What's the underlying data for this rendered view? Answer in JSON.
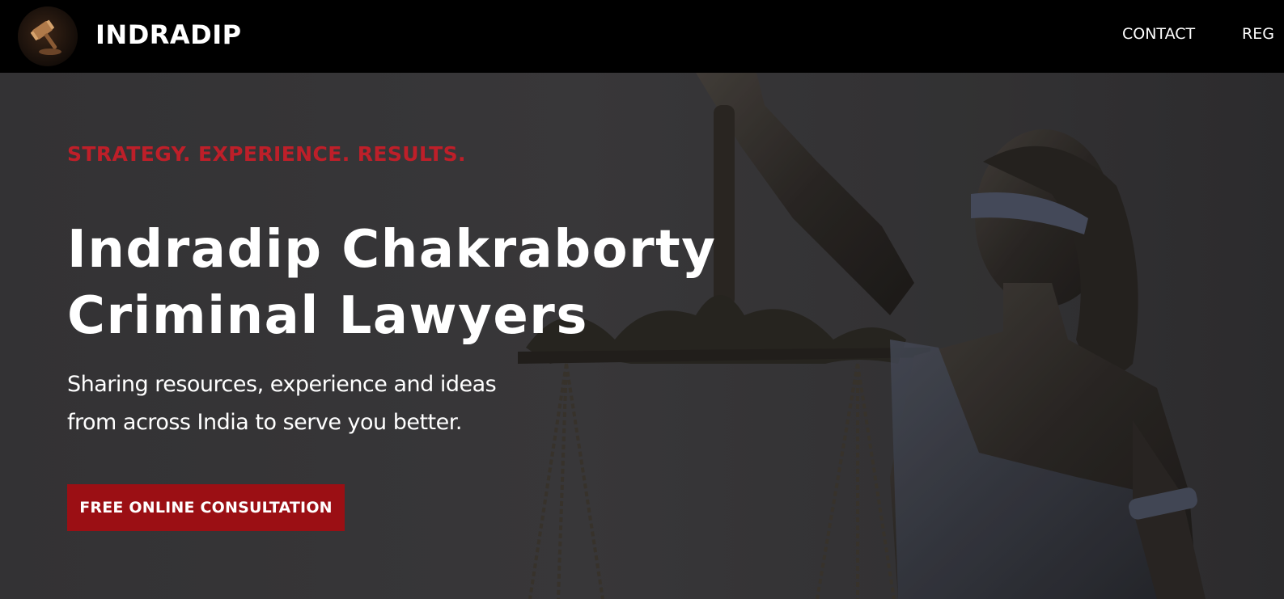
{
  "header": {
    "brand_name": "INDRADIP",
    "logo_icon": "gavel-icon",
    "nav": [
      {
        "label": "CONTACT"
      },
      {
        "label": "REG"
      }
    ]
  },
  "hero": {
    "tagline": "STRATEGY. EXPERIENCE. RESULTS.",
    "title_lines": [
      "Indradip Chakraborty",
      "Criminal Lawyers"
    ],
    "subtitle_lines": [
      "Sharing resources, experience and ideas",
      "from across India to serve you better."
    ],
    "cta_label": "FREE ONLINE CONSULTATION",
    "background_image": "lady-justice-statue"
  },
  "colors": {
    "header_bg": "#000000",
    "accent_red": "#be1f29",
    "button_red": "#9b0f14",
    "hero_bg": "#3c3b3d",
    "text": "#ffffff"
  }
}
